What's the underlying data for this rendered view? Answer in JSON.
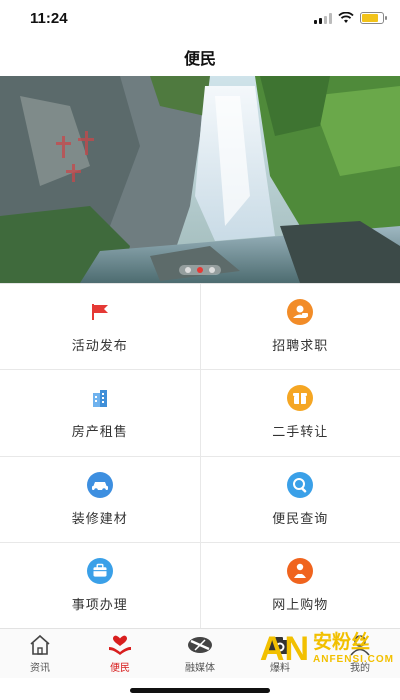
{
  "status_bar": {
    "time": "11:24",
    "battery_level": 0.8,
    "colors": {
      "battery": "#f2c31a"
    }
  },
  "nav": {
    "title": "便民"
  },
  "banner": {
    "image": "waterfall-cliff-photo",
    "slides": 3,
    "active_slide": 2
  },
  "grid": [
    {
      "label": "活动发布",
      "icon": "flag-icon",
      "color": "#e53935"
    },
    {
      "label": "招聘求职",
      "icon": "recruit-icon",
      "color": "#f28c28"
    },
    {
      "label": "房产租售",
      "icon": "building-icon",
      "color": "#3f8fd8"
    },
    {
      "label": "二手转让",
      "icon": "gift-icon",
      "color": "#f5a623"
    },
    {
      "label": "装修建材",
      "icon": "car-icon",
      "color": "#3d8fe0"
    },
    {
      "label": "便民查询",
      "icon": "search-icon",
      "color": "#3aa0e8"
    },
    {
      "label": "事项办理",
      "icon": "briefcase-icon",
      "color": "#3aa0e8"
    },
    {
      "label": "网上购物",
      "icon": "shopper-icon",
      "color": "#f0641e"
    }
  ],
  "tabs": [
    {
      "label": "资讯",
      "icon": "home-icon",
      "active": false
    },
    {
      "label": "便民",
      "icon": "heart-hand-icon",
      "active": true
    },
    {
      "label": "融媒体",
      "icon": "media-icon",
      "active": false
    },
    {
      "label": "爆料",
      "icon": "camera-icon",
      "active": false
    },
    {
      "label": "我的",
      "icon": "user-icon",
      "active": false
    }
  ],
  "watermark": {
    "logo": "AN",
    "cn": "安粉丝",
    "en": "ANFENSI.COM"
  }
}
